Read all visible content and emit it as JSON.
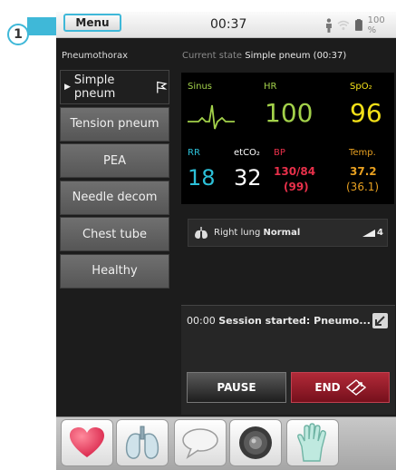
{
  "callout": {
    "number": "1"
  },
  "statusbar": {
    "menu_label": "Menu",
    "time": "00:37",
    "battery": "100 %"
  },
  "case": {
    "title": "Pneumothorax",
    "current_state_label": "Current state",
    "current_state_value": "Simple pneum (00:37)"
  },
  "states": [
    {
      "label": "Simple pneum",
      "active": true
    },
    {
      "label": "Tension pneum",
      "active": false
    },
    {
      "label": "PEA",
      "active": false
    },
    {
      "label": "Needle decom",
      "active": false
    },
    {
      "label": "Chest tube",
      "active": false
    },
    {
      "label": "Healthy",
      "active": false
    }
  ],
  "vitals": {
    "rhythm": {
      "label": "Sinus",
      "color": "#a3d14a"
    },
    "hr": {
      "label": "HR",
      "value": "100",
      "color": "#a3d14a"
    },
    "spo2": {
      "label": "SpO₂",
      "value": "96",
      "color": "#f3e018"
    },
    "rr": {
      "label": "RR",
      "value": "18",
      "color": "#2cc0d8"
    },
    "etco2": {
      "label": "etCO₂",
      "value": "32",
      "color": "#ffffff"
    },
    "bp": {
      "label": "BP",
      "value": "130/84",
      "mean": "(99)",
      "color": "#e8304a"
    },
    "temp": {
      "label": "Temp.",
      "value": "37.2",
      "secondary": "(36.1)",
      "color": "#e8a020"
    }
  },
  "lungs": {
    "side": "Right lung",
    "sound": "Normal",
    "level": "4"
  },
  "log": {
    "time": "00:00",
    "message": "Session started: Pneumo..."
  },
  "controls": {
    "pause": "PAUSE",
    "end": "END"
  },
  "tools": [
    {
      "icon": "heart-icon"
    },
    {
      "icon": "lungs-icon"
    },
    {
      "icon": "speech-bubble-icon"
    },
    {
      "icon": "speaker-icon"
    },
    {
      "icon": "glove-icon"
    }
  ]
}
